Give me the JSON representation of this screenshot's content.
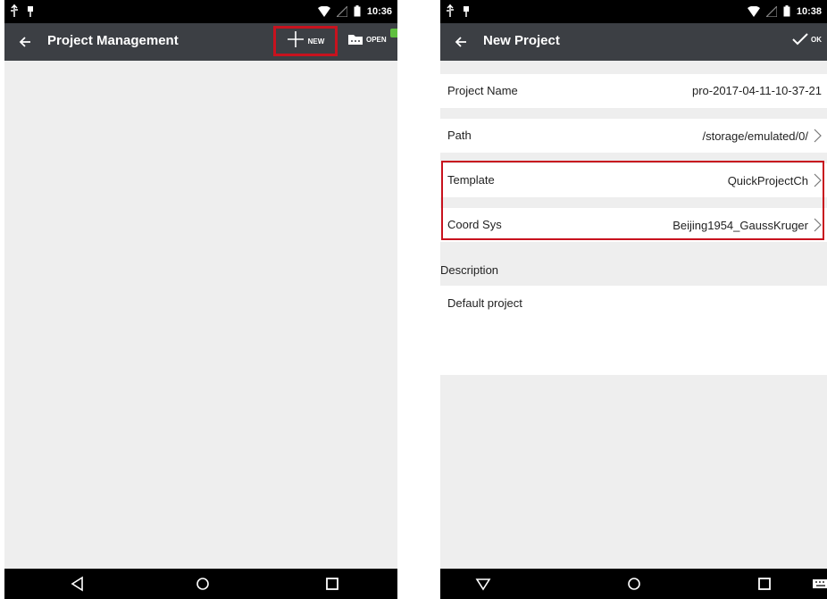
{
  "left_screen": {
    "status_bar": {
      "time": "10:36",
      "icons": [
        "usb-icon",
        "notification-icon",
        "wifi-icon",
        "signal-icon",
        "battery-icon"
      ]
    },
    "app_bar": {
      "title": "Project Management",
      "back_icon": "arrow-left-icon",
      "new_button": {
        "label": "NEW",
        "icon": "plus-icon"
      },
      "open_button": {
        "label": "OPEN",
        "icon": "folder-icon"
      }
    },
    "nav_bar": [
      "back-triangle-icon",
      "home-circle-icon",
      "recents-square-icon"
    ]
  },
  "right_screen": {
    "status_bar": {
      "time": "10:38",
      "icons": [
        "usb-icon",
        "notification-icon",
        "wifi-icon",
        "signal-icon",
        "battery-icon"
      ]
    },
    "app_bar": {
      "title": "New Project",
      "back_icon": "arrow-left-icon",
      "ok_button": {
        "label": "OK",
        "icon": "checkmark-icon"
      }
    },
    "fields": {
      "project_name": {
        "label": "Project Name",
        "value": "pro-2017-04-11-10-37-21"
      },
      "path": {
        "label": "Path",
        "value": "/storage/emulated/0/"
      },
      "template": {
        "label": "Template",
        "value": "QuickProjectCh"
      },
      "coord_sys": {
        "label": "Coord Sys",
        "value": "Beijing1954_GaussKruger"
      }
    },
    "description": {
      "label": "Description",
      "value": "Default project"
    },
    "nav_bar": [
      "back-down-triangle-icon",
      "home-circle-icon",
      "recents-square-icon",
      "keyboard-icon"
    ]
  },
  "colors": {
    "highlight": "#c8121e",
    "app_bar": "#3c3f44",
    "background": "#eeeeee"
  }
}
